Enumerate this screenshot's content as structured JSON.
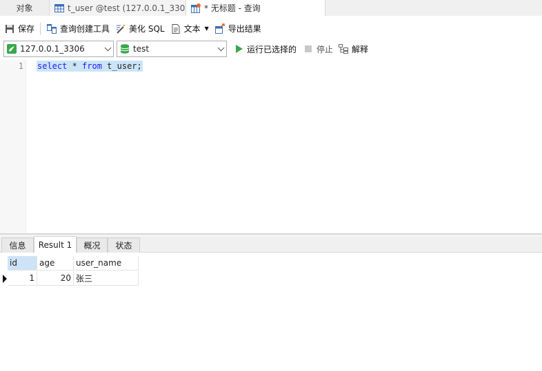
{
  "tabs": {
    "objects_label": "对象",
    "table_tab_label": "t_user @test (127.0.0.1_3306...",
    "query_tab_label": "* 无标题 - 查询"
  },
  "toolbar": {
    "save_label": "保存",
    "query_builder_label": "查询创建工具",
    "beautify_label": "美化 SQL",
    "text_label": "文本",
    "export_label": "导出结果"
  },
  "connection": {
    "server": "127.0.0.1_3306",
    "database": "test",
    "run_selected_label": "运行已选择的",
    "stop_label": "停止",
    "explain_label": "解释"
  },
  "editor": {
    "line_number": "1",
    "kw_select": "select",
    "star": " * ",
    "kw_from": "from",
    "table": " t_user;"
  },
  "result_tabs": {
    "info": "信息",
    "result1": "Result 1",
    "overview": "概况",
    "status": "状态"
  },
  "result_grid": {
    "columns": [
      "id",
      "age",
      "user_name"
    ],
    "rows": [
      [
        "1",
        "20",
        "张三"
      ]
    ]
  },
  "colors": {
    "accent_green": "#3aa84a",
    "selection_blue": "#cce4f7",
    "keyword_blue": "#1a1aff"
  }
}
